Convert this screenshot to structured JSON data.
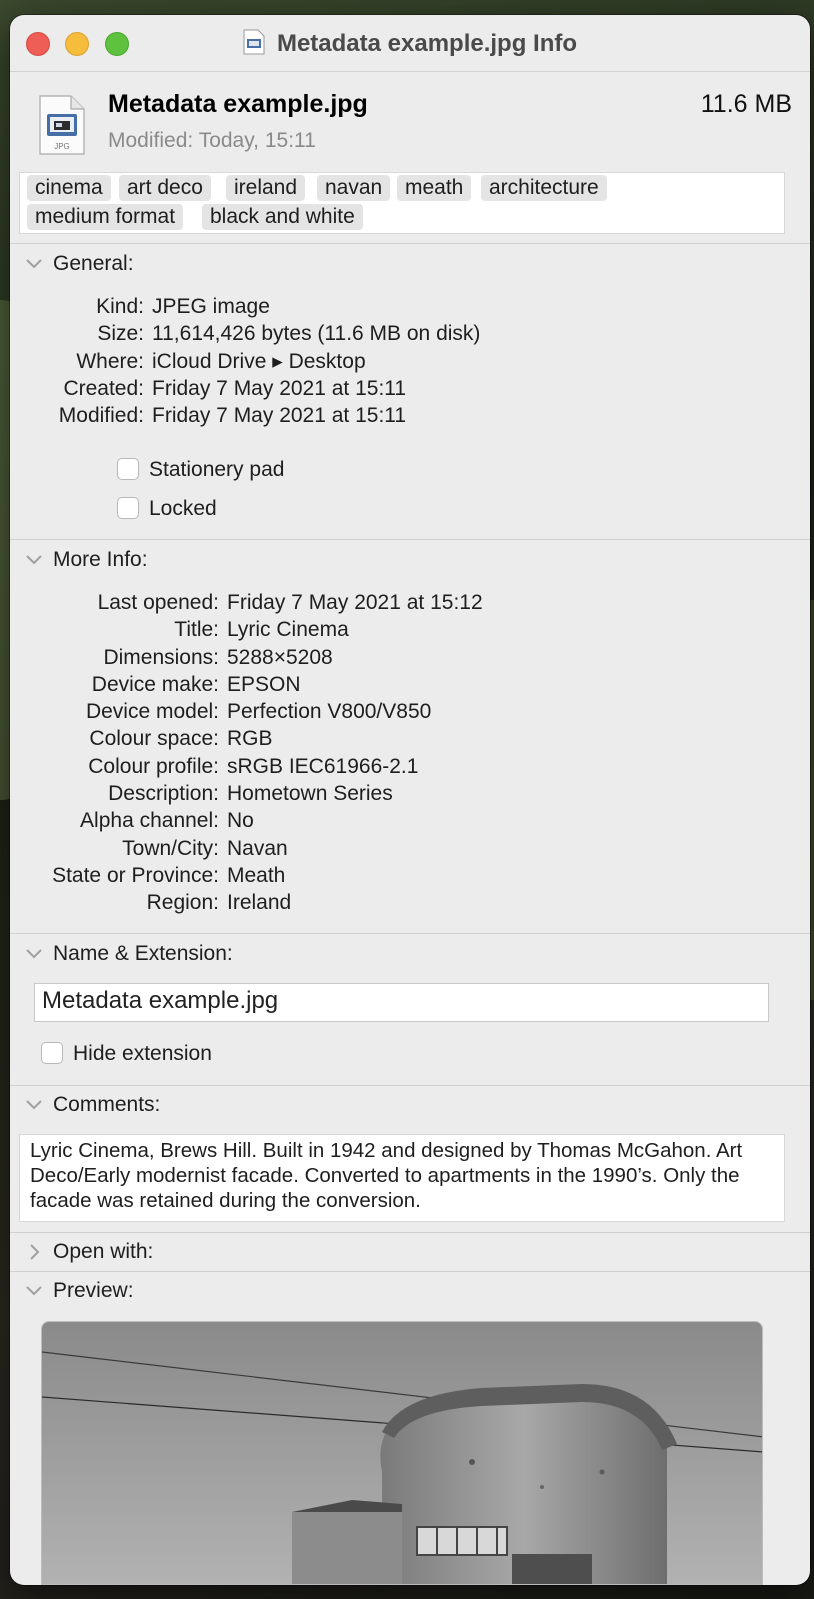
{
  "window": {
    "title": "Metadata example.jpg Info"
  },
  "header": {
    "file_name": "Metadata example.jpg",
    "size": "11.6 MB",
    "modified_label": "Modified:",
    "modified_value": "Today, 15:11",
    "icon_label": "JPG"
  },
  "tags": [
    "cinema",
    "art deco",
    "ireland",
    "navan",
    "meath",
    "architecture",
    "medium format",
    "black and white"
  ],
  "general": {
    "heading": "General:",
    "rows": [
      {
        "key": "Kind:",
        "value": "JPEG image"
      },
      {
        "key": "Size:",
        "value": "11,614,426 bytes (11.6 MB on disk)"
      },
      {
        "key": "Where:",
        "value": "iCloud Drive ▸ Desktop"
      },
      {
        "key": "Created:",
        "value": "Friday 7 May 2021 at 15:11"
      },
      {
        "key": "Modified:",
        "value": "Friday 7 May 2021 at 15:11"
      }
    ],
    "stationery_label": "Stationery pad",
    "stationery_checked": false,
    "locked_label": "Locked",
    "locked_checked": false
  },
  "more_info": {
    "heading": "More Info:",
    "rows": [
      {
        "key": "Last opened:",
        "value": "Friday 7 May 2021 at 15:12"
      },
      {
        "key": "Title:",
        "value": "Lyric Cinema"
      },
      {
        "key": "Dimensions:",
        "value": "5288×5208"
      },
      {
        "key": "Device make:",
        "value": "EPSON"
      },
      {
        "key": "Device model:",
        "value": "Perfection V800/V850"
      },
      {
        "key": "Colour space:",
        "value": "RGB"
      },
      {
        "key": "Colour profile:",
        "value": "sRGB IEC61966-2.1"
      },
      {
        "key": "Description:",
        "value": "Hometown Series"
      },
      {
        "key": "Alpha channel:",
        "value": "No"
      },
      {
        "key": "Town/City:",
        "value": "Navan"
      },
      {
        "key": "State or Province:",
        "value": "Meath"
      },
      {
        "key": "Region:",
        "value": "Ireland"
      }
    ]
  },
  "name_extension": {
    "heading": "Name & Extension:",
    "value": "Metadata example.jpg",
    "hide_extension_label": "Hide extension",
    "hide_extension_checked": false
  },
  "comments": {
    "heading": "Comments:",
    "text": "Lyric Cinema, Brews Hill. Built in 1942 and designed by Thomas McGahon. Art Deco/Early modernist facade. Converted to apartments in the 1990’s. Only the facade was retained during the conversion."
  },
  "open_with": {
    "heading": "Open with:",
    "expanded": false
  },
  "preview": {
    "heading": "Preview:",
    "expanded": true
  },
  "colors": {
    "close": "#ee5e57",
    "minimize": "#f5bd3b",
    "maximize": "#5fc23f",
    "window_bg": "#ececec",
    "tag_bg": "#e4e4e4"
  }
}
